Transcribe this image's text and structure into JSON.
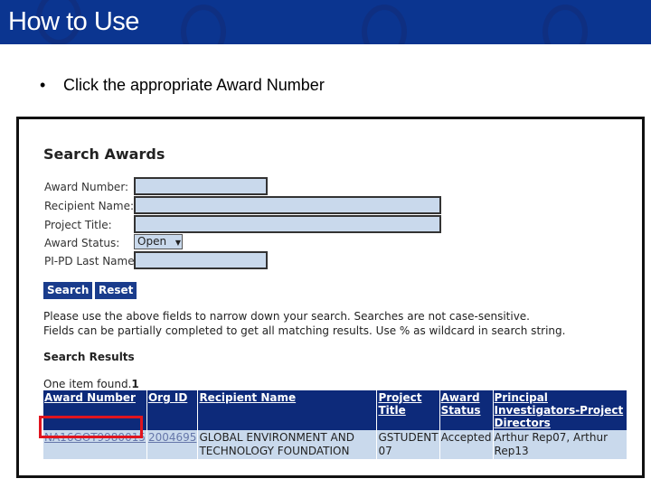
{
  "slide": {
    "title": "How to Use",
    "bullet": "Click the appropriate Award Number"
  },
  "form": {
    "heading": "Search Awards",
    "fields": [
      {
        "label": "Award Number:",
        "value": ""
      },
      {
        "label": "Recipient Name:",
        "value": ""
      },
      {
        "label": "Project Title:",
        "value": ""
      },
      {
        "label": "Award Status:",
        "value": "Open"
      },
      {
        "label": "PI-PD Last Name:",
        "value": ""
      }
    ],
    "search_label": "Search",
    "reset_label": "Reset",
    "note1": "Please use the above fields to narrow down your search. Searches are not case-sensitive.",
    "note2": "Fields can be partially completed to get all matching results. Use % as wildcard in search string."
  },
  "results": {
    "heading": "Search Results",
    "found": "One item found.",
    "count": "1",
    "columns": [
      "Award Number",
      "Org ID",
      "Recipient Name",
      "Project Title",
      "Award Status",
      "Principal Investigators-Project Directors"
    ],
    "rows": [
      [
        "NA16GOT9980015",
        "2004695",
        "GLOBAL ENVIRONMENT AND TECHNOLOGY FOUNDATION",
        "GSTUDENT 07",
        "Accepted",
        "Arthur Rep07, Arthur Rep13"
      ]
    ]
  },
  "colors": {
    "header": "#0b3590",
    "highlight": "#e0141e",
    "input": "#c9d9ec"
  }
}
